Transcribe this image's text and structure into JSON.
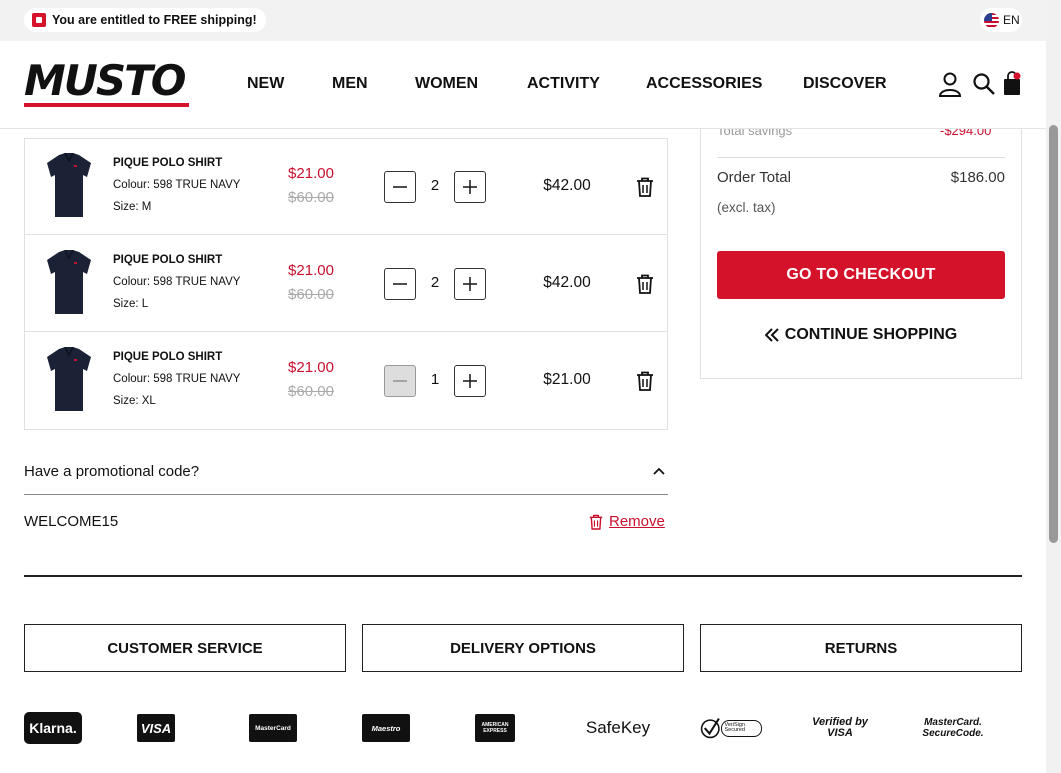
{
  "banner": {
    "shipping_text": "You are entitled to FREE shipping!",
    "language": "EN"
  },
  "header": {
    "logo_text": "MUSTO",
    "nav": [
      "NEW",
      "MEN",
      "WOMEN",
      "ACTIVITY",
      "ACCESSORIES",
      "DISCOVER"
    ]
  },
  "cart": {
    "items": [
      {
        "name": "PIQUE POLO SHIRT",
        "colour": "Colour: 598 TRUE NAVY",
        "size": "Size: M",
        "price": "$21.00",
        "was": "$60.00",
        "qty": "2",
        "total": "$42.00",
        "minus_disabled": false
      },
      {
        "name": "PIQUE POLO SHIRT",
        "colour": "Colour: 598 TRUE NAVY",
        "size": "Size: L",
        "price": "$21.00",
        "was": "$60.00",
        "qty": "2",
        "total": "$42.00",
        "minus_disabled": false
      },
      {
        "name": "PIQUE POLO SHIRT",
        "colour": "Colour: 598 TRUE NAVY",
        "size": "Size: XL",
        "price": "$21.00",
        "was": "$60.00",
        "qty": "1",
        "total": "$21.00",
        "minus_disabled": true
      }
    ]
  },
  "promo": {
    "heading": "Have a promotional code?",
    "code": "WELCOME15",
    "remove_label": "Remove"
  },
  "summary": {
    "savings_label": "Total savings",
    "savings_value": "-$294.00",
    "order_total_label": "Order Total",
    "order_total_value": "$186.00",
    "tax_note": "(excl. tax)",
    "checkout_label": "GO TO CHECKOUT",
    "continue_label": "CONTINUE SHOPPING"
  },
  "footer": {
    "buttons": [
      "CUSTOMER SERVICE",
      "DELIVERY OPTIONS",
      "RETURNS"
    ],
    "payment_logos": [
      "Klarna.",
      "VISA",
      "MasterCard",
      "Maestro",
      "AMERICAN EXPRESS",
      "SafeKey",
      "VeriSign Secured",
      "Verified by VISA",
      "MasterCard. SecureCode."
    ]
  },
  "colors": {
    "brand_red": "#d4122a",
    "price_red": "#c8102e"
  }
}
